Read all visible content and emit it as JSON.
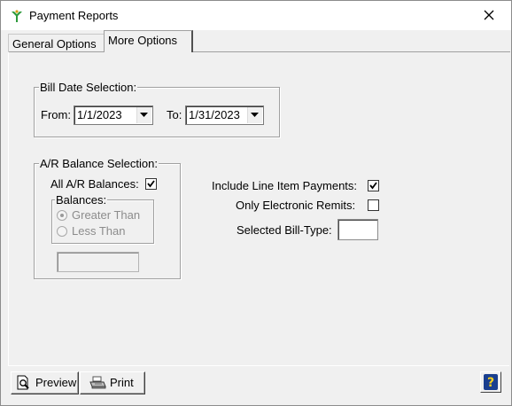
{
  "window": {
    "title": "Payment Reports",
    "close_glyph": "✕"
  },
  "tabs": [
    {
      "label": "General Options",
      "selected": false
    },
    {
      "label": "More Options",
      "selected": true
    }
  ],
  "bill_date": {
    "legend": "Bill Date Selection:",
    "from_label": "From:",
    "from_value": "1/1/2023",
    "to_label": "To:",
    "to_value": "1/31/2023"
  },
  "ar_balance": {
    "legend": "A/R Balance Selection:",
    "all_label": "All A/R Balances:",
    "all_checked": true,
    "balances": {
      "legend": "Balances:",
      "greater_than": "Greater Than",
      "less_than": "Less Than",
      "selected": "Greater Than",
      "amount_value": ""
    }
  },
  "options": {
    "include_line_items_label": "Include Line Item Payments:",
    "include_line_items_checked": true,
    "only_electronic_label": "Only Electronic Remits:",
    "only_electronic_checked": false,
    "bill_type_label": "Selected Bill-Type:",
    "bill_type_value": ""
  },
  "toolbar": {
    "preview_label": "Preview",
    "print_label": "Print",
    "help_glyph": "?"
  },
  "icons": {
    "app": "green-tree-logo-icon",
    "preview": "magnifier-document-icon",
    "print": "printer-icon",
    "help": "help-question-icon"
  },
  "colors": {
    "window_bg": "#f0f0f0",
    "app_icon": "#2e9a3c",
    "help_bg": "#1a3f8f"
  }
}
